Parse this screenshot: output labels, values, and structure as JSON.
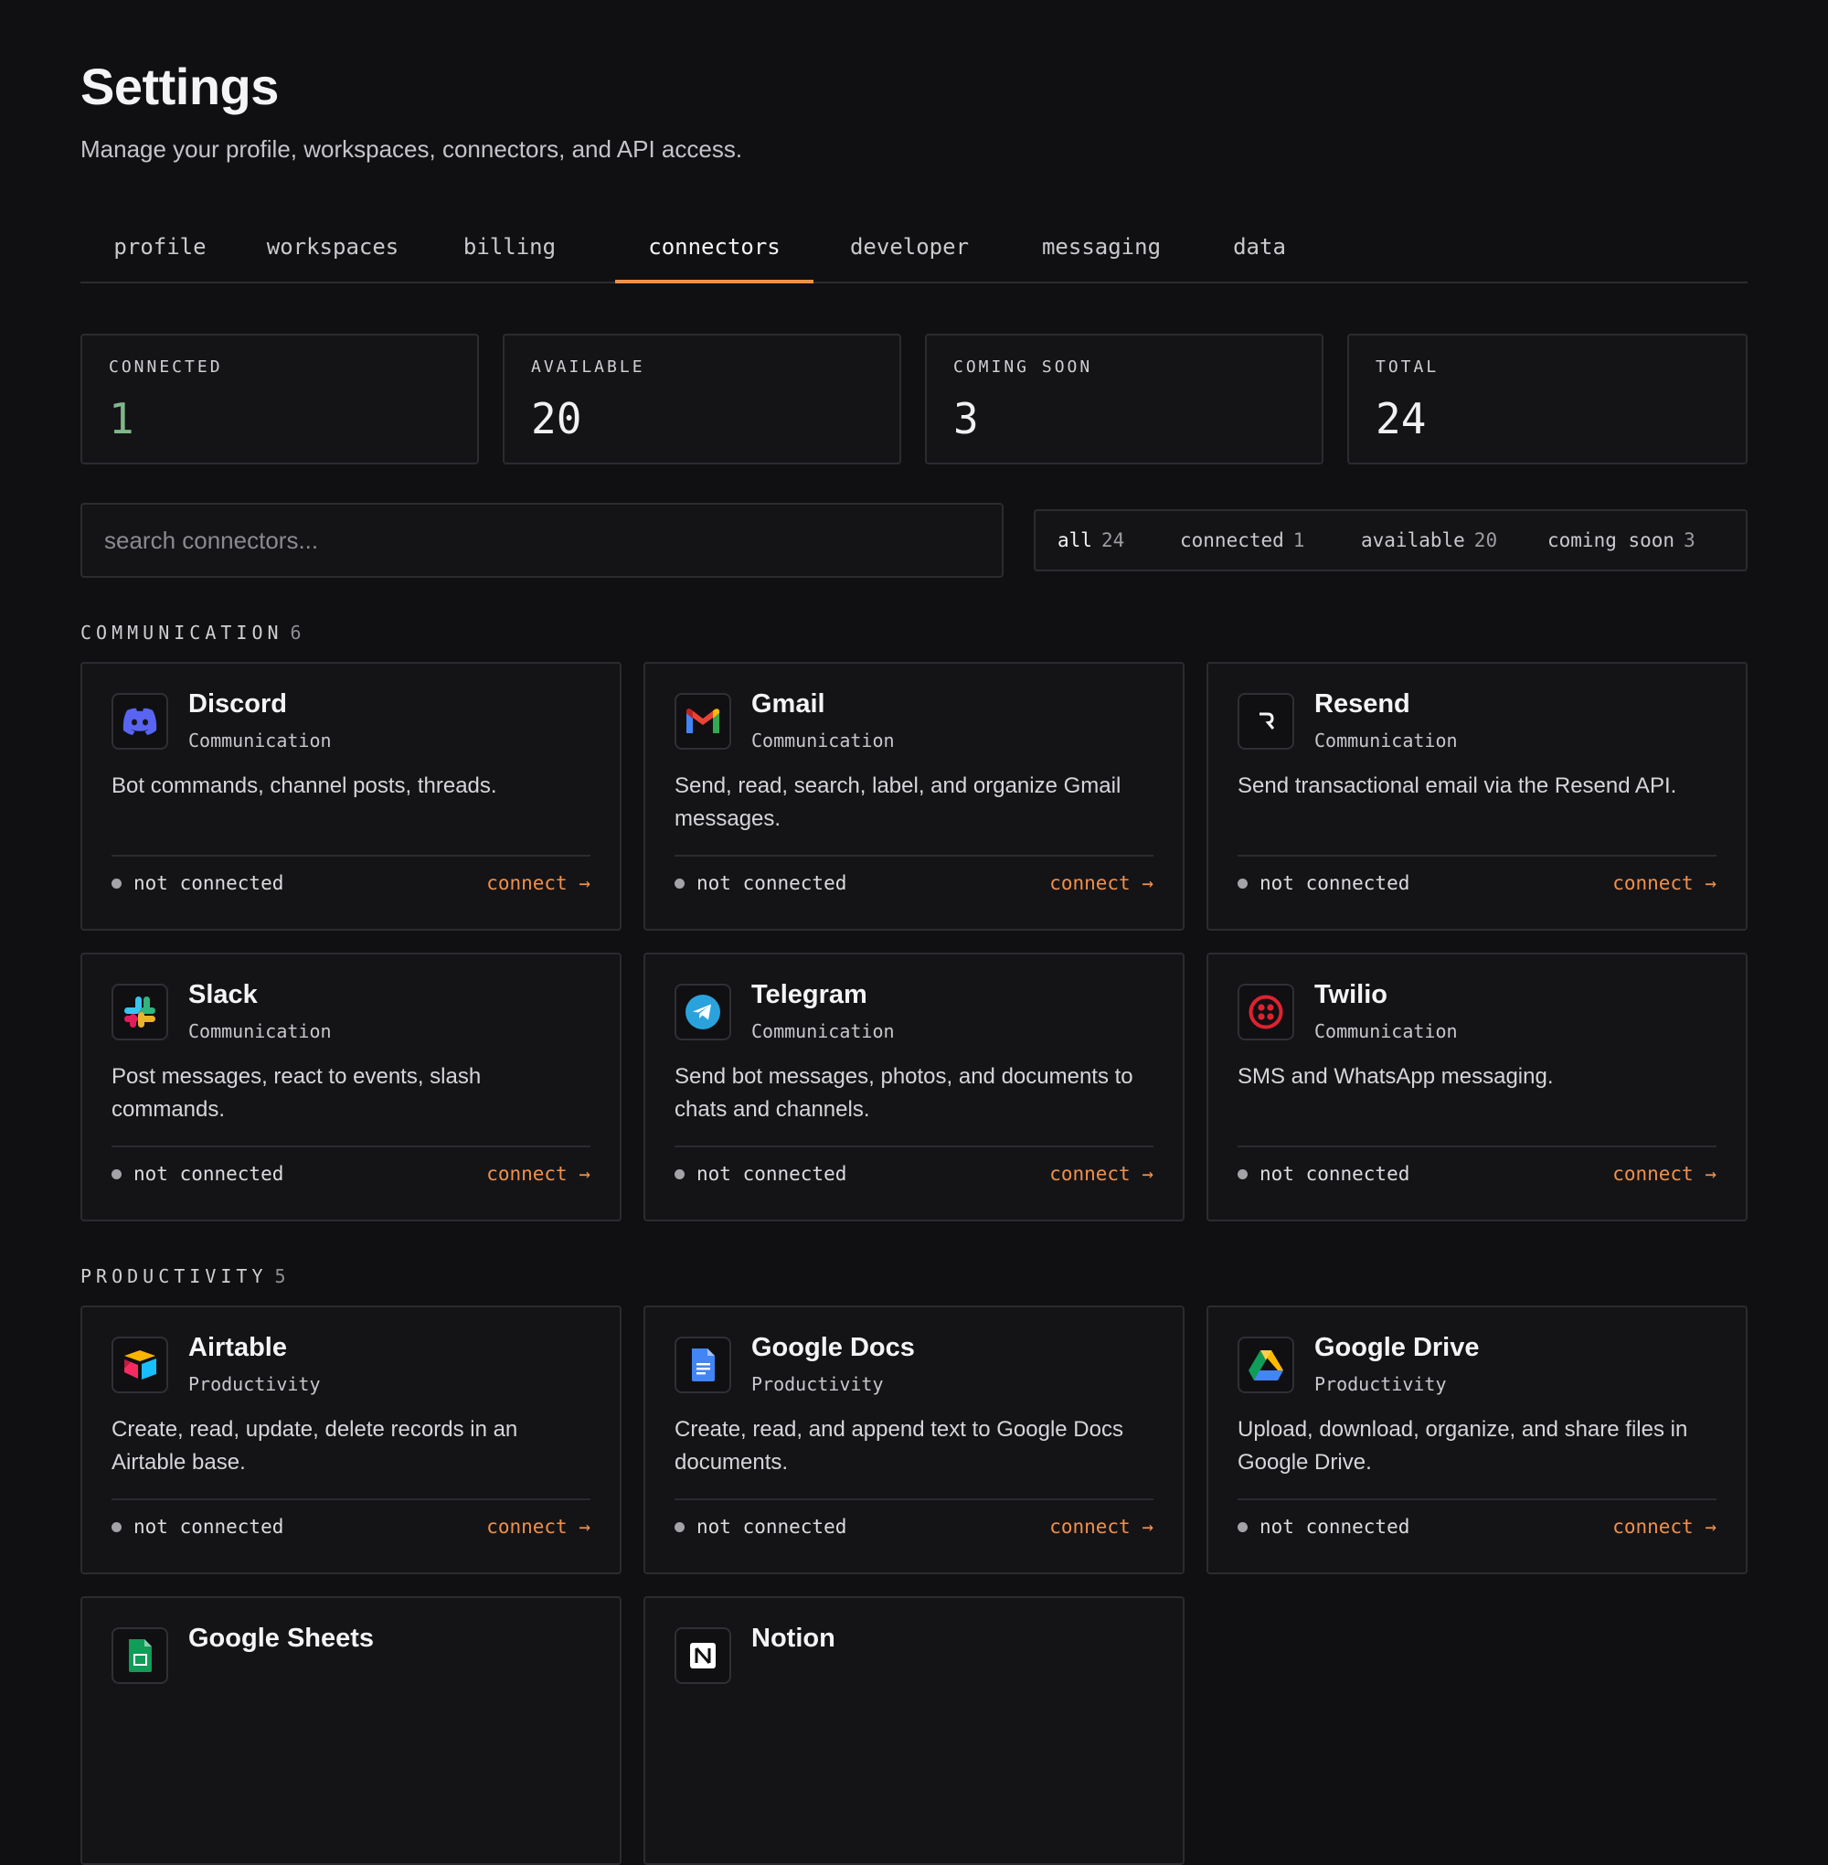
{
  "header": {
    "title": "Settings",
    "subtitle": "Manage your profile, workspaces, connectors, and API access."
  },
  "tabs": [
    {
      "label": "profile"
    },
    {
      "label": "workspaces"
    },
    {
      "label": "billing"
    },
    {
      "label": "connectors",
      "active": true
    },
    {
      "label": "developer"
    },
    {
      "label": "messaging"
    },
    {
      "label": "data"
    }
  ],
  "stats": [
    {
      "label": "CONNECTED",
      "value": "1",
      "color": "#7fb88a"
    },
    {
      "label": "AVAILABLE",
      "value": "20"
    },
    {
      "label": "COMING SOON",
      "value": "3"
    },
    {
      "label": "TOTAL",
      "value": "24"
    }
  ],
  "search": {
    "placeholder": "search connectors..."
  },
  "filters": [
    {
      "label": "all",
      "count": "24",
      "active": true
    },
    {
      "label": "connected",
      "count": "1"
    },
    {
      "label": "available",
      "count": "20"
    },
    {
      "label": "coming soon",
      "count": "3"
    }
  ],
  "accent_color": "#f0904a",
  "sections": [
    {
      "title": "COMMUNICATION",
      "count": "6",
      "cards": [
        {
          "name": "Discord",
          "category": "Communication",
          "icon": "discord-icon",
          "description": "Bot commands, channel posts, threads.",
          "status": "not connected",
          "action": "connect →"
        },
        {
          "name": "Gmail",
          "category": "Communication",
          "icon": "gmail-icon",
          "description": "Send, read, search, label, and organize Gmail messages.",
          "status": "not connected",
          "action": "connect →"
        },
        {
          "name": "Resend",
          "category": "Communication",
          "icon": "resend-icon",
          "description": "Send transactional email via the Resend API.",
          "status": "not connected",
          "action": "connect →"
        },
        {
          "name": "Slack",
          "category": "Communication",
          "icon": "slack-icon",
          "description": "Post messages, react to events, slash commands.",
          "status": "not connected",
          "action": "connect →"
        },
        {
          "name": "Telegram",
          "category": "Communication",
          "icon": "telegram-icon",
          "description": "Send bot messages, photos, and documents to chats and channels.",
          "status": "not connected",
          "action": "connect →"
        },
        {
          "name": "Twilio",
          "category": "Communication",
          "icon": "twilio-icon",
          "description": "SMS and WhatsApp messaging.",
          "status": "not connected",
          "action": "connect →"
        }
      ]
    },
    {
      "title": "PRODUCTIVITY",
      "count": "5",
      "cards": [
        {
          "name": "Airtable",
          "category": "Productivity",
          "icon": "airtable-icon",
          "description": "Create, read, update, delete records in an Airtable base.",
          "status": "not connected",
          "action": "connect →"
        },
        {
          "name": "Google Docs",
          "category": "Productivity",
          "icon": "google-docs-icon",
          "description": "Create, read, and append text to Google Docs documents.",
          "status": "not connected",
          "action": "connect →"
        },
        {
          "name": "Google Drive",
          "category": "Productivity",
          "icon": "google-drive-icon",
          "description": "Upload, download, organize, and share files in Google Drive.",
          "status": "not connected",
          "action": "connect →"
        },
        {
          "name": "Google Sheets",
          "category": "",
          "icon": "google-sheets-icon",
          "description": "",
          "status": "",
          "action": ""
        },
        {
          "name": "Notion",
          "category": "",
          "icon": "notion-icon",
          "description": "",
          "status": "",
          "action": ""
        }
      ]
    }
  ]
}
